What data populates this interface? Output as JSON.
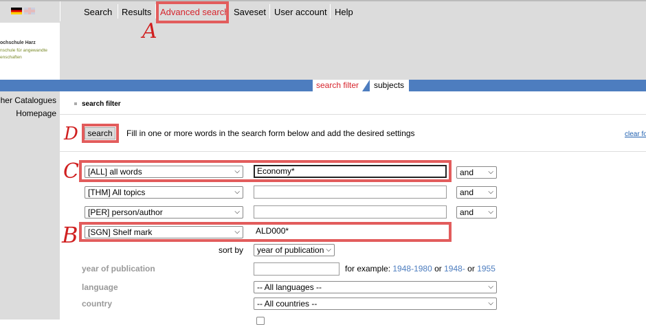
{
  "nav": {
    "search": "Search",
    "results": "Results",
    "advanced_search": "Advanced search",
    "saveset": "Saveset",
    "user_account": "User account",
    "help": "Help",
    "active_color": "#d6242c"
  },
  "logo": {
    "line1": "ochschule Harz",
    "line2": "nschule für angewandte",
    "line3": "enschaften"
  },
  "tabs": {
    "search_filter": "search filter",
    "subjects": "subjects"
  },
  "sidebar": {
    "item1": "her Catalogues",
    "item2": "Homepage"
  },
  "content": {
    "section_label": "search filter",
    "search_button": "search",
    "instructions": "Fill in one or more words in the search form below and add the desired settings",
    "clear_form": "clear fo"
  },
  "rows": [
    {
      "field": "[ALL] all words",
      "value": "Economy*",
      "operator": "and"
    },
    {
      "field": "[THM] All topics",
      "value": "",
      "operator": "and"
    },
    {
      "field": "[PER] person/author",
      "value": "",
      "operator": "and"
    },
    {
      "field": "[SGN] Shelf mark",
      "value": "ALD000*"
    }
  ],
  "sort": {
    "label": "sort by",
    "value": "year of publication"
  },
  "year": {
    "label": "year of publication",
    "example_prefix": "for example:",
    "ex1": "1948-1980",
    "or1": "or",
    "ex2": "1948-",
    "or2": "or",
    "ex3": "1955"
  },
  "language": {
    "label": "language",
    "value": "-- All languages --"
  },
  "country": {
    "label": "country",
    "value": "-- All countries --"
  },
  "annotations": {
    "a": "A",
    "b": "B",
    "c": "C",
    "d": "D",
    "color": "#e25c5c"
  }
}
